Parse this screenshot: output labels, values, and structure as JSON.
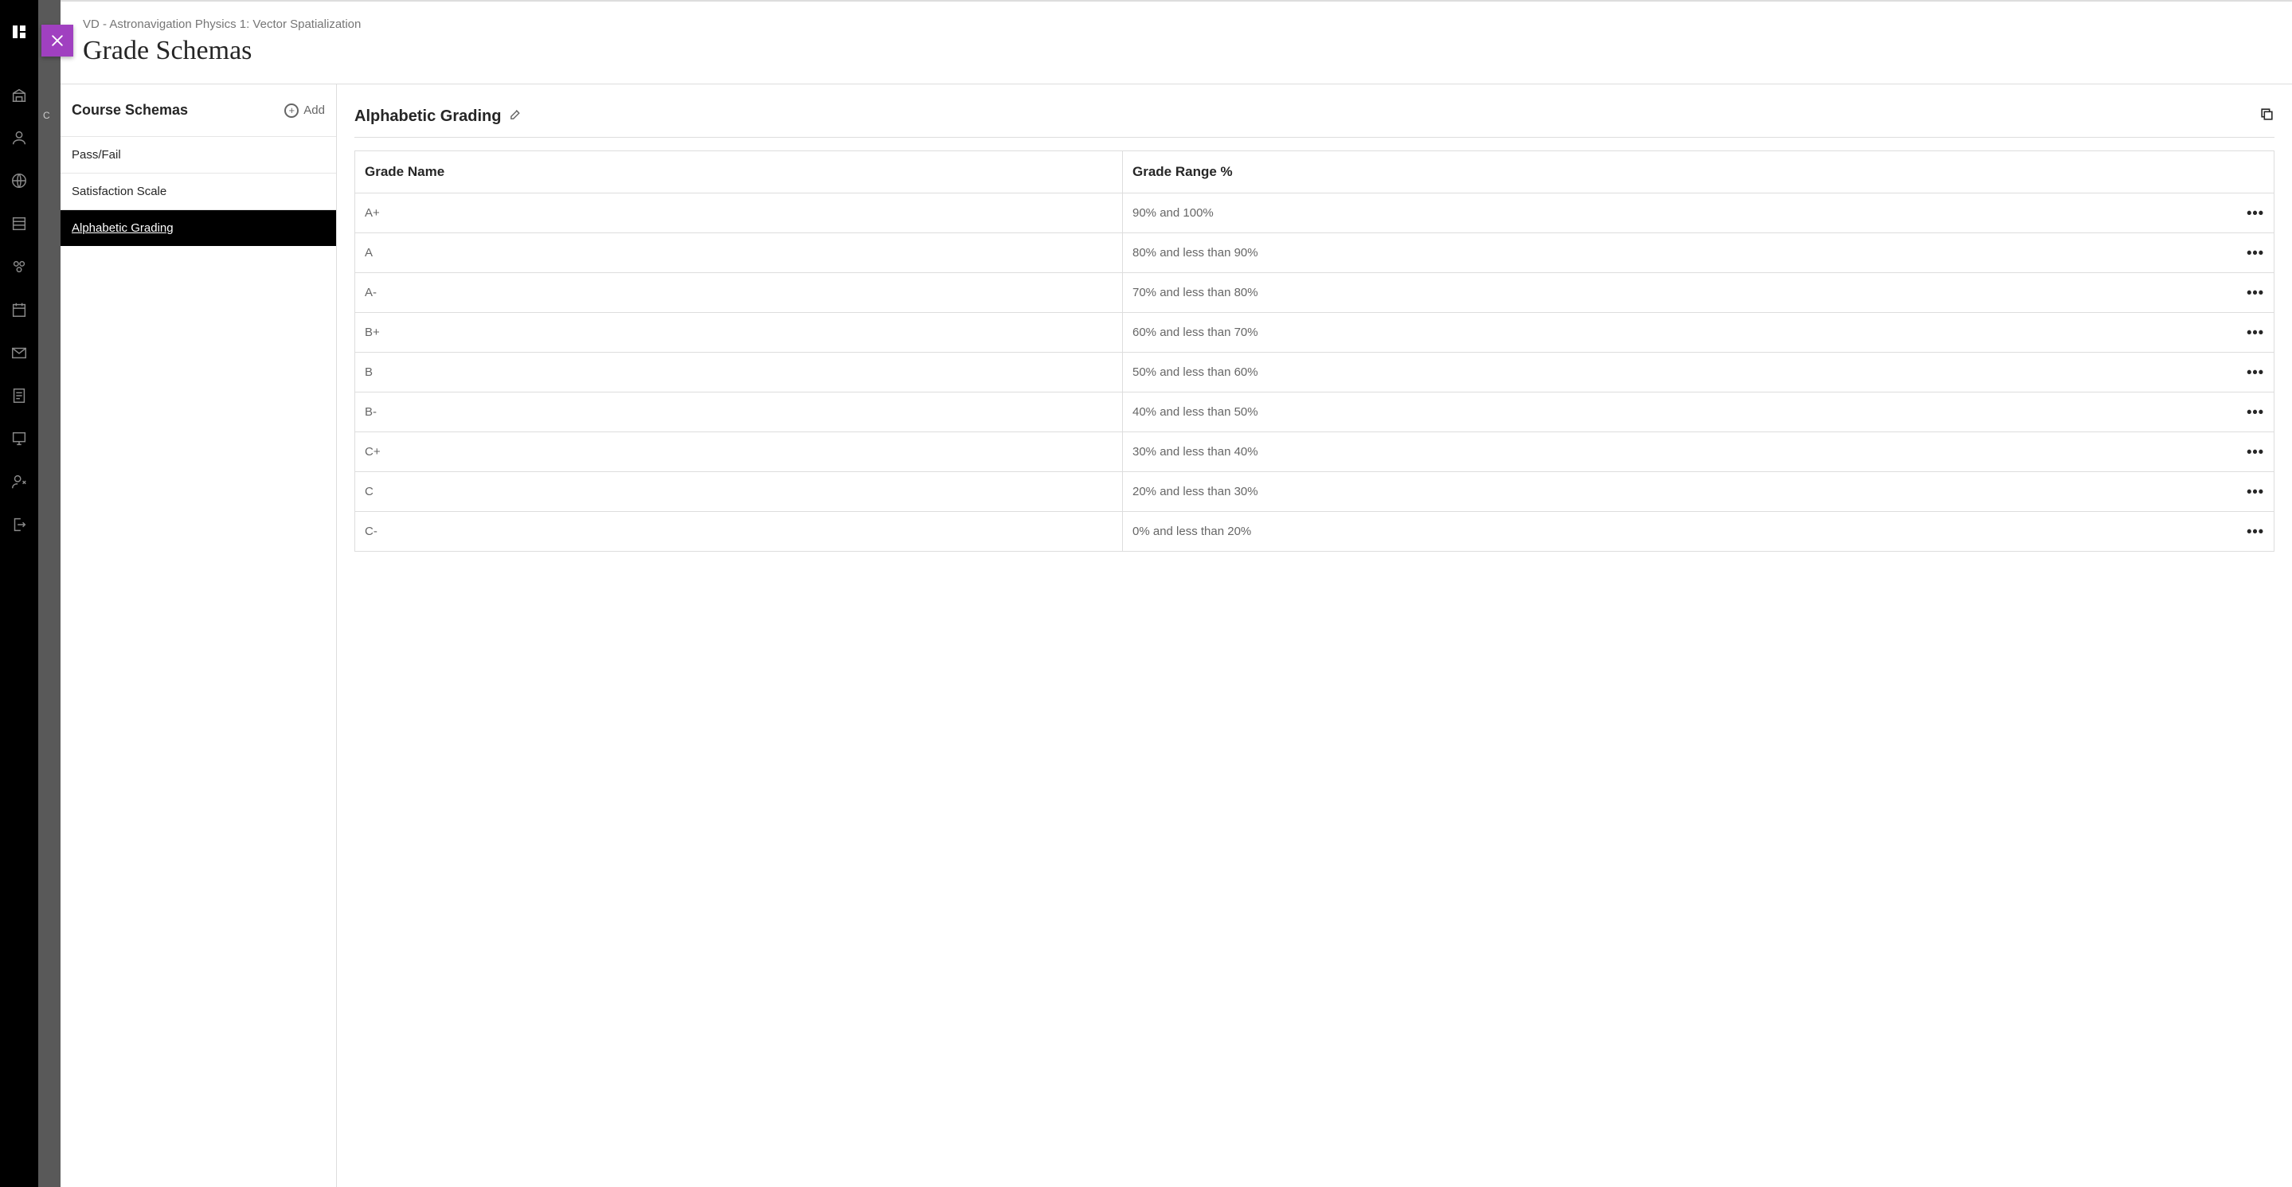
{
  "breadcrumb": "VD - Astronavigation Physics 1: Vector Spatialization",
  "page_title": "Grade Schemas",
  "sidebar": {
    "title": "Course Schemas",
    "add_label": "Add",
    "items": [
      {
        "label": "Pass/Fail"
      },
      {
        "label": "Satisfaction Scale"
      },
      {
        "label": "Alphabetic Grading"
      }
    ],
    "active_index": 2
  },
  "detail": {
    "title": "Alphabetic Grading",
    "columns": {
      "name": "Grade Name",
      "range": "Grade Range %"
    },
    "rows": [
      {
        "name": "A+",
        "range": "90%  and  100%"
      },
      {
        "name": "A",
        "range": "80%  and less than  90%"
      },
      {
        "name": "A-",
        "range": "70%  and less than  80%"
      },
      {
        "name": "B+",
        "range": "60%  and less than  70%"
      },
      {
        "name": "B",
        "range": "50%  and less than  60%"
      },
      {
        "name": "B-",
        "range": "40%  and less than  50%"
      },
      {
        "name": "C+",
        "range": "30%  and less than  40%"
      },
      {
        "name": "C",
        "range": "20%  and less than  30%"
      },
      {
        "name": "C-",
        "range": "0%  and less than  20%"
      }
    ]
  }
}
